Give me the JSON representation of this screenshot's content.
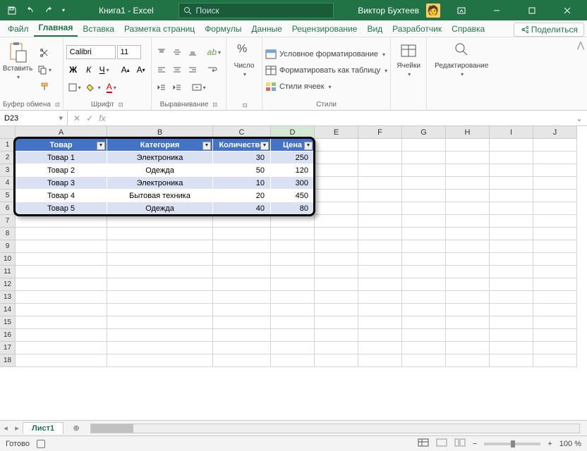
{
  "title": "Книга1 - Excel",
  "search_placeholder": "Поиск",
  "user": "Виктор Бухтеев",
  "tabs": {
    "file": "Файл",
    "home": "Главная",
    "insert": "Вставка",
    "layout": "Разметка страниц",
    "formulas": "Формулы",
    "data": "Данные",
    "review": "Рецензирование",
    "view": "Вид",
    "dev": "Разработчик",
    "help": "Справка",
    "share": "Поделиться"
  },
  "ribbon": {
    "paste": "Вставить",
    "clipboard": "Буфер обмена",
    "font_name": "Calibri",
    "font_size": "11",
    "font_group": "Шрифт",
    "align_group": "Выравнивание",
    "number": "Число",
    "cond": "Условное форматирование",
    "as_table": "Форматировать как таблицу",
    "cell_styles": "Стили ячеек",
    "styles": "Стили",
    "cells": "Ячейки",
    "editing": "Редактирование"
  },
  "namebox": "D23",
  "columns": [
    "A",
    "B",
    "C",
    "D",
    "E",
    "F",
    "G",
    "H",
    "I",
    "J"
  ],
  "table": {
    "headers": [
      "Товар",
      "Категория",
      "Количество",
      "Цена"
    ],
    "rows": [
      [
        "Товар 1",
        "Электроника",
        "30",
        "250"
      ],
      [
        "Товар 2",
        "Одежда",
        "50",
        "120"
      ],
      [
        "Товар 3",
        "Электроника",
        "10",
        "300"
      ],
      [
        "Товар 4",
        "Бытовая техника",
        "20",
        "450"
      ],
      [
        "Товар 5",
        "Одежда",
        "40",
        "80"
      ]
    ]
  },
  "sheet": "Лист1",
  "status": "Готово",
  "zoom": "100 %"
}
